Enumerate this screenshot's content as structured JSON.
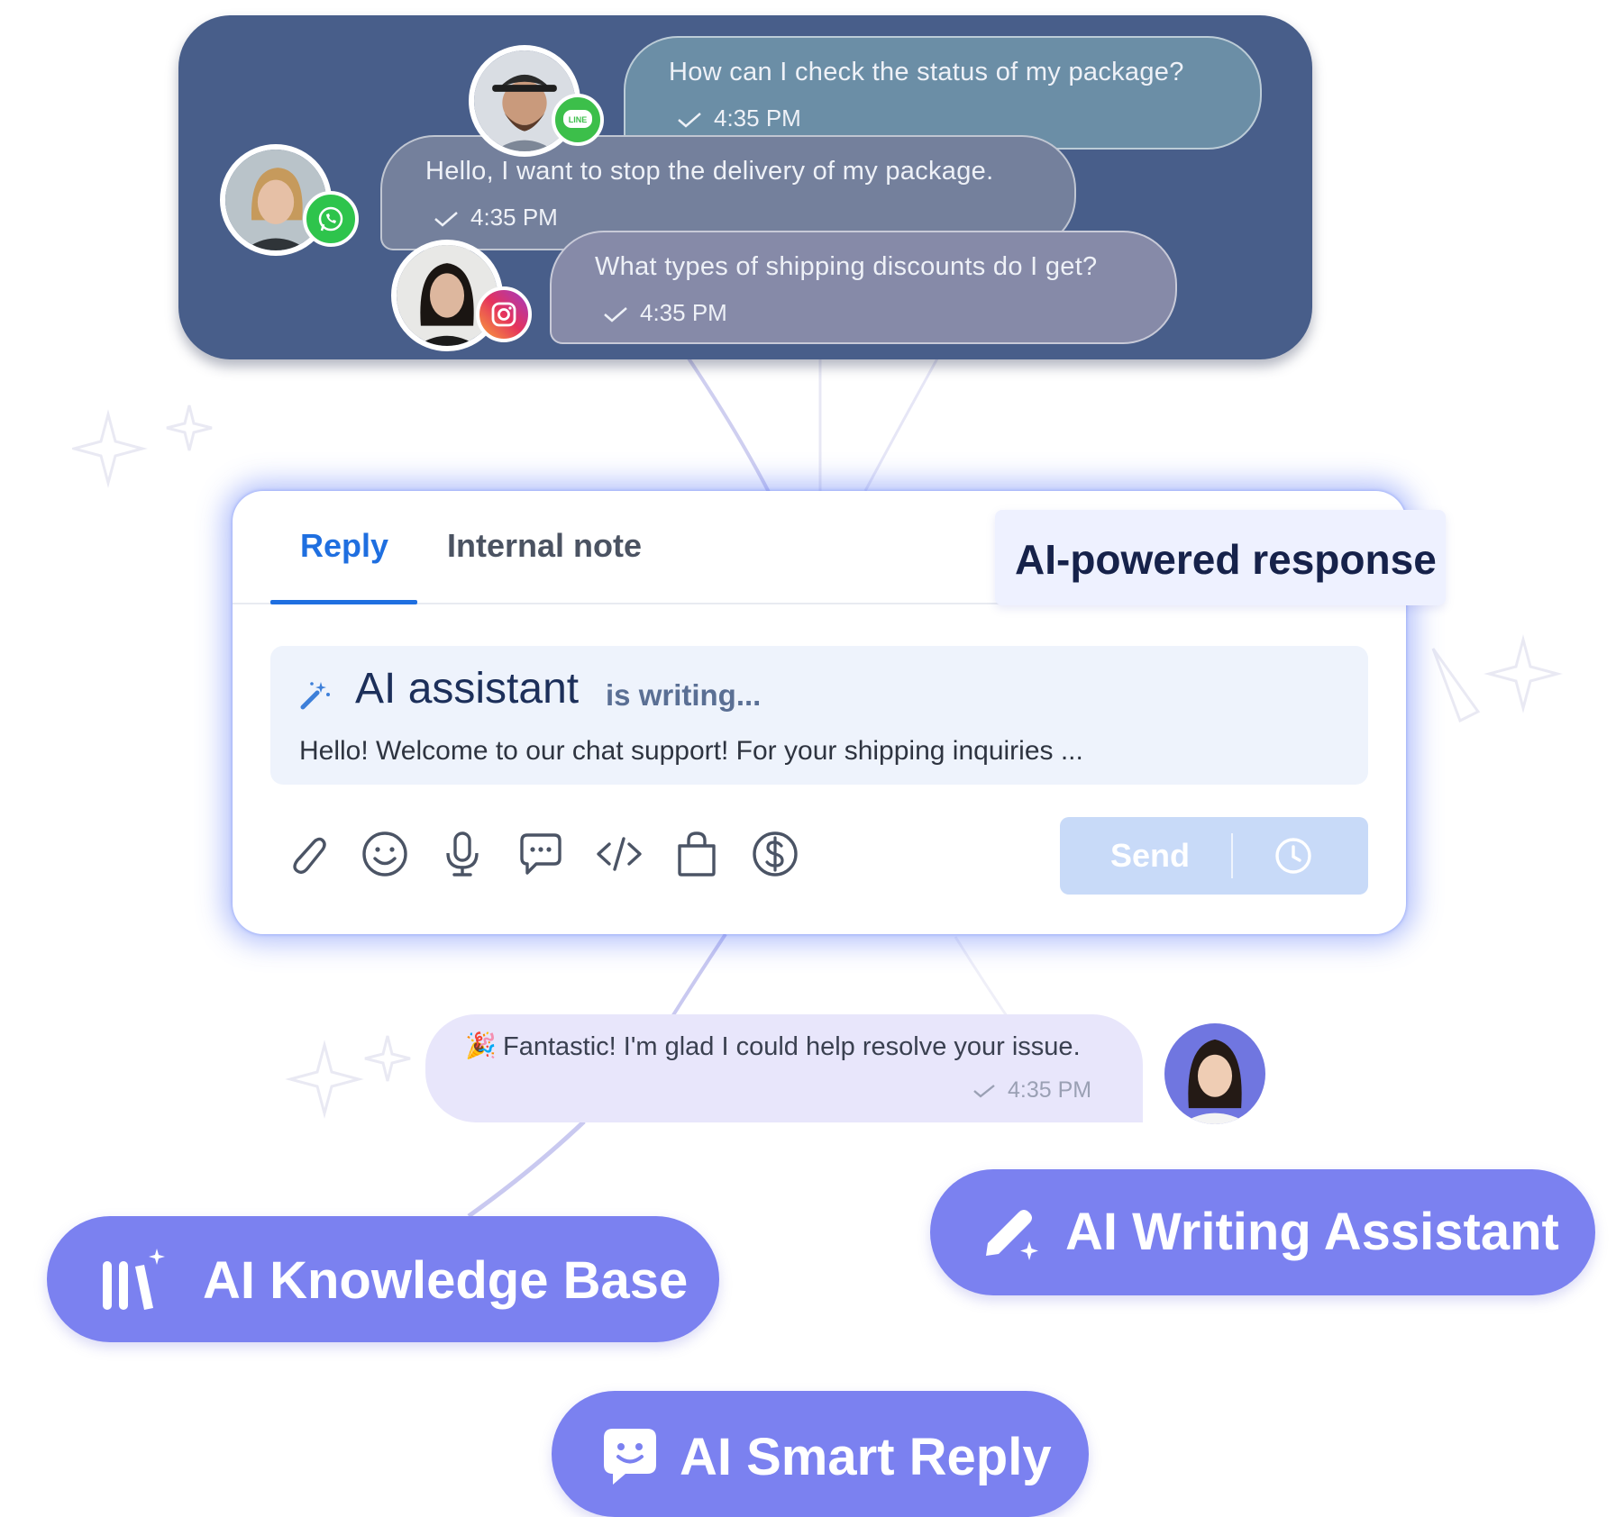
{
  "conversations": [
    {
      "message": "How can I check the status of my package?",
      "time": "4:35 PM",
      "channel": "line-icon",
      "channel_label": "LINE"
    },
    {
      "message": "Hello, I want to stop the delivery of my package.",
      "time": "4:35 PM",
      "channel": "whatsapp-icon"
    },
    {
      "message": "What types of shipping discounts do I get?",
      "time": "4:35 PM",
      "channel": "instagram-icon"
    }
  ],
  "composer": {
    "tabs": [
      {
        "label": "Reply",
        "active": true
      },
      {
        "label": "Internal note",
        "active": false
      }
    ],
    "ai_assistant": {
      "title": "AI assistant",
      "status": "is writing...",
      "draft": "Hello! Welcome to our chat support! For your shipping inquiries ..."
    },
    "toolbar_icons": [
      "paperclip-icon",
      "emoji-icon",
      "microphone-icon",
      "chat-bubble-icon",
      "code-icon",
      "shopping-bag-icon",
      "dollar-icon"
    ],
    "send_label": "Send",
    "schedule_icon": "clock-icon"
  },
  "callout": "AI-powered response",
  "agent_reply": {
    "message": "Fantastic! I'm glad I could help resolve your issue.",
    "time": "4:35 PM"
  },
  "features": [
    {
      "label": "AI Knowledge Base",
      "icon": "knowledge-base-icon"
    },
    {
      "label": "AI Writing Assistant",
      "icon": "pen-sparkle-icon"
    },
    {
      "label": "AI Smart Reply",
      "icon": "smart-reply-icon"
    }
  ],
  "colors": {
    "panel": "#485e8a",
    "accent": "#1f6fe0",
    "pill": "#7b81f0",
    "send_disabled": "#c8daf8",
    "glow": "#5c78f6"
  }
}
